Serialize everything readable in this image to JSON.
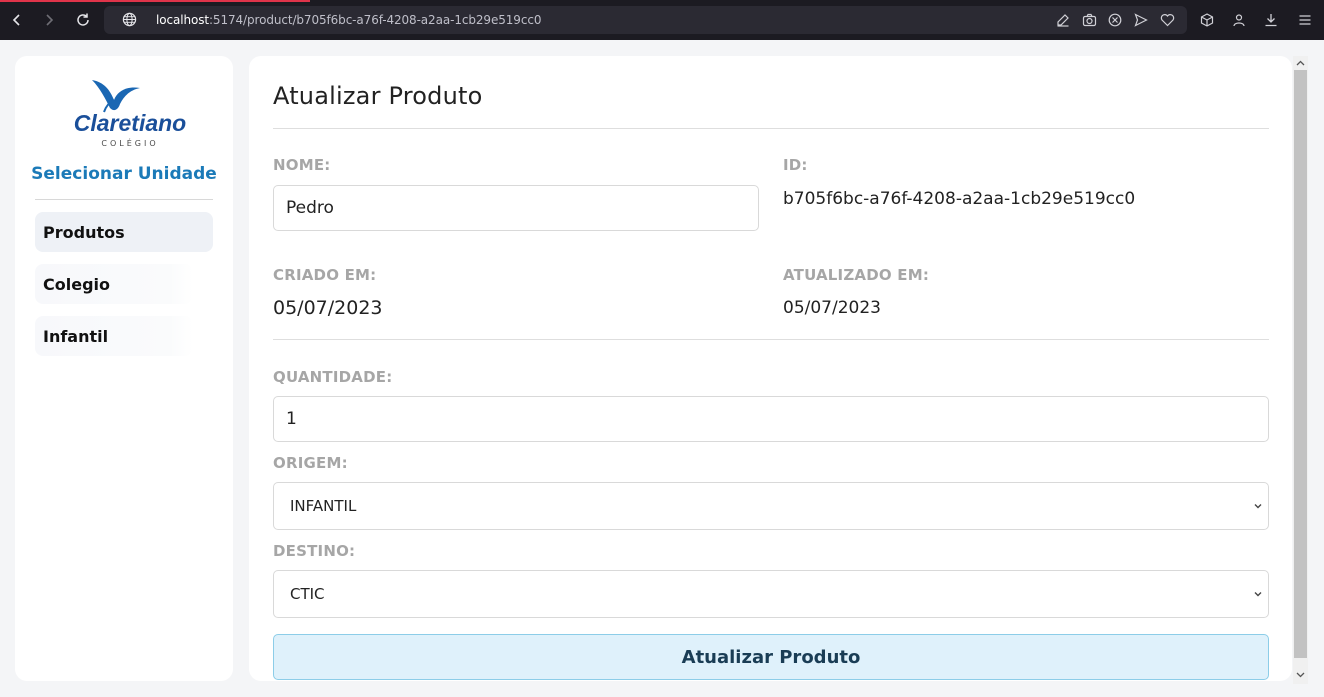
{
  "browser": {
    "url_host": "localhost",
    "url_path": ":5174/product/b705f6bc-a76f-4208-a2aa-1cb29e519cc0",
    "icons": [
      "back-icon",
      "forward-icon",
      "reload-icon",
      "globe-icon",
      "edit-icon",
      "camera-icon",
      "block-icon",
      "send-icon",
      "heart-icon",
      "cube-icon",
      "user-icon",
      "download-icon",
      "menu-icon"
    ]
  },
  "sidebar": {
    "logo_text": "Claretiano",
    "logo_subtext": "COLÉGIO",
    "select_unit": "Selecionar Unidade",
    "items": [
      {
        "label": "Produtos",
        "active": true
      },
      {
        "label": "Colegio",
        "active": false
      },
      {
        "label": "Infantil",
        "active": false
      }
    ]
  },
  "main": {
    "title": "Atualizar Produto",
    "name_label": "NOME:",
    "name_value": "Pedro",
    "id_label": "ID:",
    "id_value": "b705f6bc-a76f-4208-a2aa-1cb29e519cc0",
    "created_label": "CRIADO EM:",
    "created_value": "05/07/2023",
    "updated_label": "ATUALIZADO EM:",
    "updated_value": "05/07/2023",
    "quantity_label": "QUANTIDADE:",
    "quantity_value": "1",
    "origin_label": "ORIGEM:",
    "origin_value": "INFANTIL",
    "destination_label": "DESTINO:",
    "destination_value": "CTIC",
    "submit_label": "Atualizar Produto"
  },
  "colors": {
    "accent": "#1b7ab8",
    "button_bg": "#dff1fb",
    "button_border": "#8ccde8",
    "button_text": "#1a3d55",
    "label": "#a6a6a6"
  }
}
